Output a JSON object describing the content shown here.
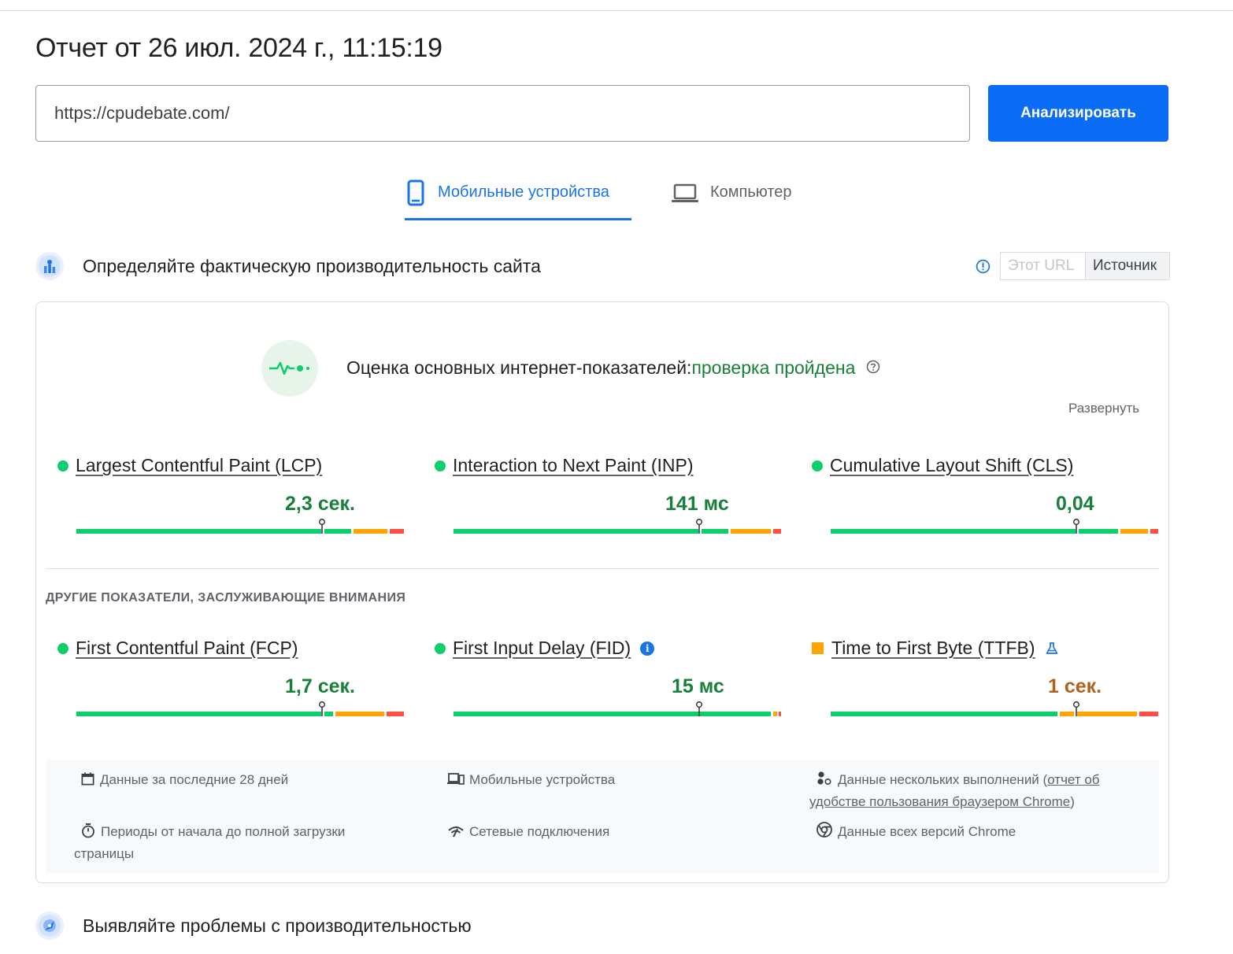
{
  "header": {
    "title": "Отчет от 26 июл. 2024 г., 11:15:19"
  },
  "search": {
    "url_value": "https://cpudebate.com/",
    "analyze_label": "Анализировать"
  },
  "tabs": [
    {
      "label": "Мобильные устройства",
      "active": true,
      "icon": "smartphone-icon"
    },
    {
      "label": "Компьютер",
      "active": false,
      "icon": "laptop-icon"
    }
  ],
  "field_section": {
    "title": "Определяйте фактическую производительность сайта",
    "toggle": {
      "this_url": "Этот URL",
      "origin": "Источник",
      "selected": "origin"
    }
  },
  "core_web_vitals": {
    "label": "Оценка основных интернет-показателей:",
    "status": "проверка пройдена",
    "expand_label": "Развернуть"
  },
  "metrics": [
    {
      "name": "Largest Contentful Paint (LCP)",
      "value": "2,3 сек.",
      "rating": "good"
    },
    {
      "name": "Interaction to Next Paint (INP)",
      "value": "141 мс",
      "rating": "good"
    },
    {
      "name": "Cumulative Layout Shift (CLS)",
      "value": "0,04",
      "rating": "good"
    }
  ],
  "other_heading": "ДРУГИЕ ПОКАЗАТЕЛИ, ЗАСЛУЖИВАЮЩИЕ ВНИМАНИЯ",
  "other_metrics": [
    {
      "name": "First Contentful Paint (FCP)",
      "value": "1,7 сек.",
      "rating": "good"
    },
    {
      "name": "First Input Delay (FID)",
      "value": "15 мс",
      "rating": "good",
      "icon": "info-filled-icon"
    },
    {
      "name": "Time to First Byte (TTFB)",
      "value": "1 сек.",
      "rating": "average",
      "icon": "flask-icon"
    }
  ],
  "info_panel": {
    "period": "Данные за последние 28 дней",
    "devices": "Мобильные устройства",
    "runs_prefix": "Данные нескольких выполнений (",
    "runs_link": "отчет об удобстве пользования браузером Chrome",
    "runs_suffix": ")",
    "duration": "Периоды от начала до полной загрузки страницы",
    "network": "Сетевые подключения",
    "chrome_versions": "Данные всех версий Chrome"
  },
  "lab_section": {
    "title": "Выявляйте проблемы с производительностью"
  },
  "colors": {
    "accent": "#1a73e8",
    "good": "#0cce6b",
    "average": "#ffa400",
    "poor": "#ff4e42",
    "good_text": "#188038",
    "average_text": "#b45f18"
  }
}
